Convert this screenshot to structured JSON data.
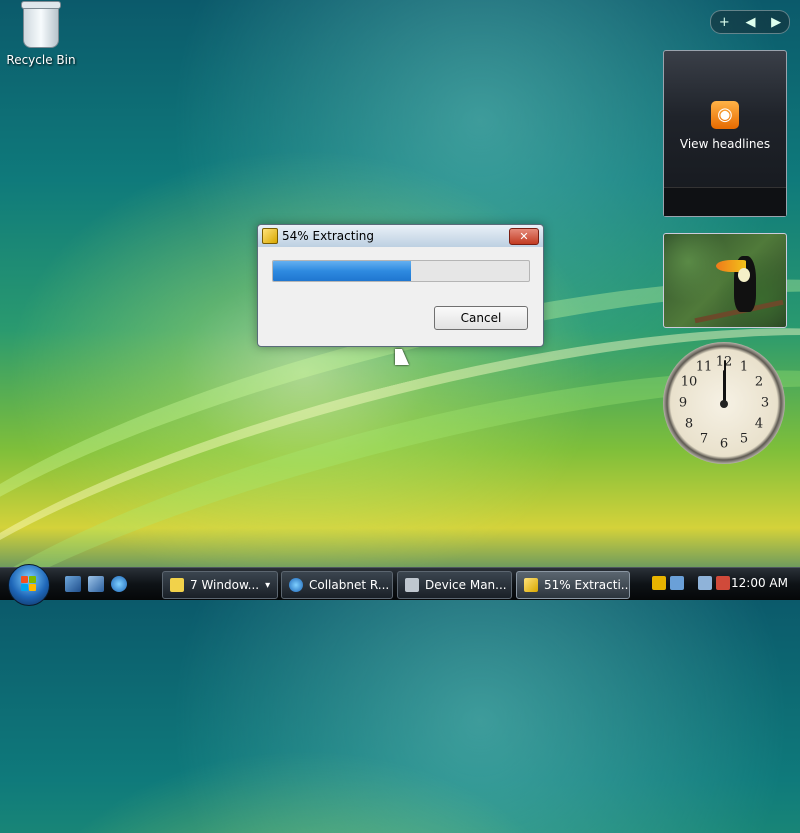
{
  "desktop": {
    "recycle_bin_label": "Recycle Bin"
  },
  "sidebar": {
    "controls": [
      "+",
      "◀",
      "▶"
    ],
    "feed_gadget": {
      "text": "View headlines",
      "icon": "rss-icon"
    },
    "clock_numbers": [
      "12",
      "1",
      "2",
      "3",
      "4",
      "5",
      "6",
      "7",
      "8",
      "9",
      "10",
      "11"
    ]
  },
  "dialog": {
    "title": "54% Extracting",
    "close_label": "✕",
    "progress_percent": 54,
    "cancel_label": "Cancel"
  },
  "taskbar": {
    "tasks": [
      {
        "label": "7 Window...",
        "arrow": "▾"
      },
      {
        "label": "Collabnet R..."
      },
      {
        "label": "Device Man..."
      },
      {
        "label": "51% Extracti..."
      }
    ],
    "clock": "12:00 AM"
  },
  "colors": {
    "progress_fill": "#2e8ae0",
    "close_button": "#c23b22"
  }
}
